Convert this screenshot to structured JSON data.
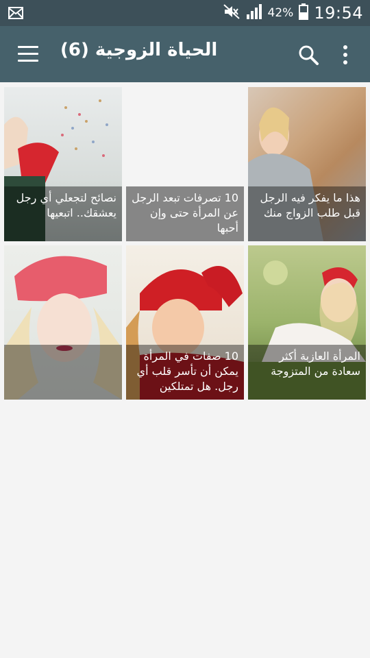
{
  "status_bar": {
    "battery": "42%",
    "time": "19:54",
    "icons": [
      "mail-icon",
      "mute-icon",
      "signal-icon",
      "battery-icon"
    ]
  },
  "app_bar": {
    "title": "الحياة الزوجية (6)",
    "icons": [
      "menu-icon",
      "search-icon",
      "more-vert-icon"
    ]
  },
  "articles": [
    {
      "caption": "هذا ما يفكر فيه الرجل قبل طلب الزواج منك"
    },
    {
      "caption": "10 تصرفات تبعد الرجل عن المرأة حتى وإن أحبها"
    },
    {
      "caption": "نصائح لتجعلي أي رجل يعشقك.. اتبعيها"
    },
    {
      "caption": "المرأة العازبة أكثر سعادة من المتزوجة"
    },
    {
      "caption": "10 صفات في المرأة يمكن أن تأسر قلب أي رجل. هل تمتلكين"
    },
    {
      "caption": ""
    }
  ]
}
